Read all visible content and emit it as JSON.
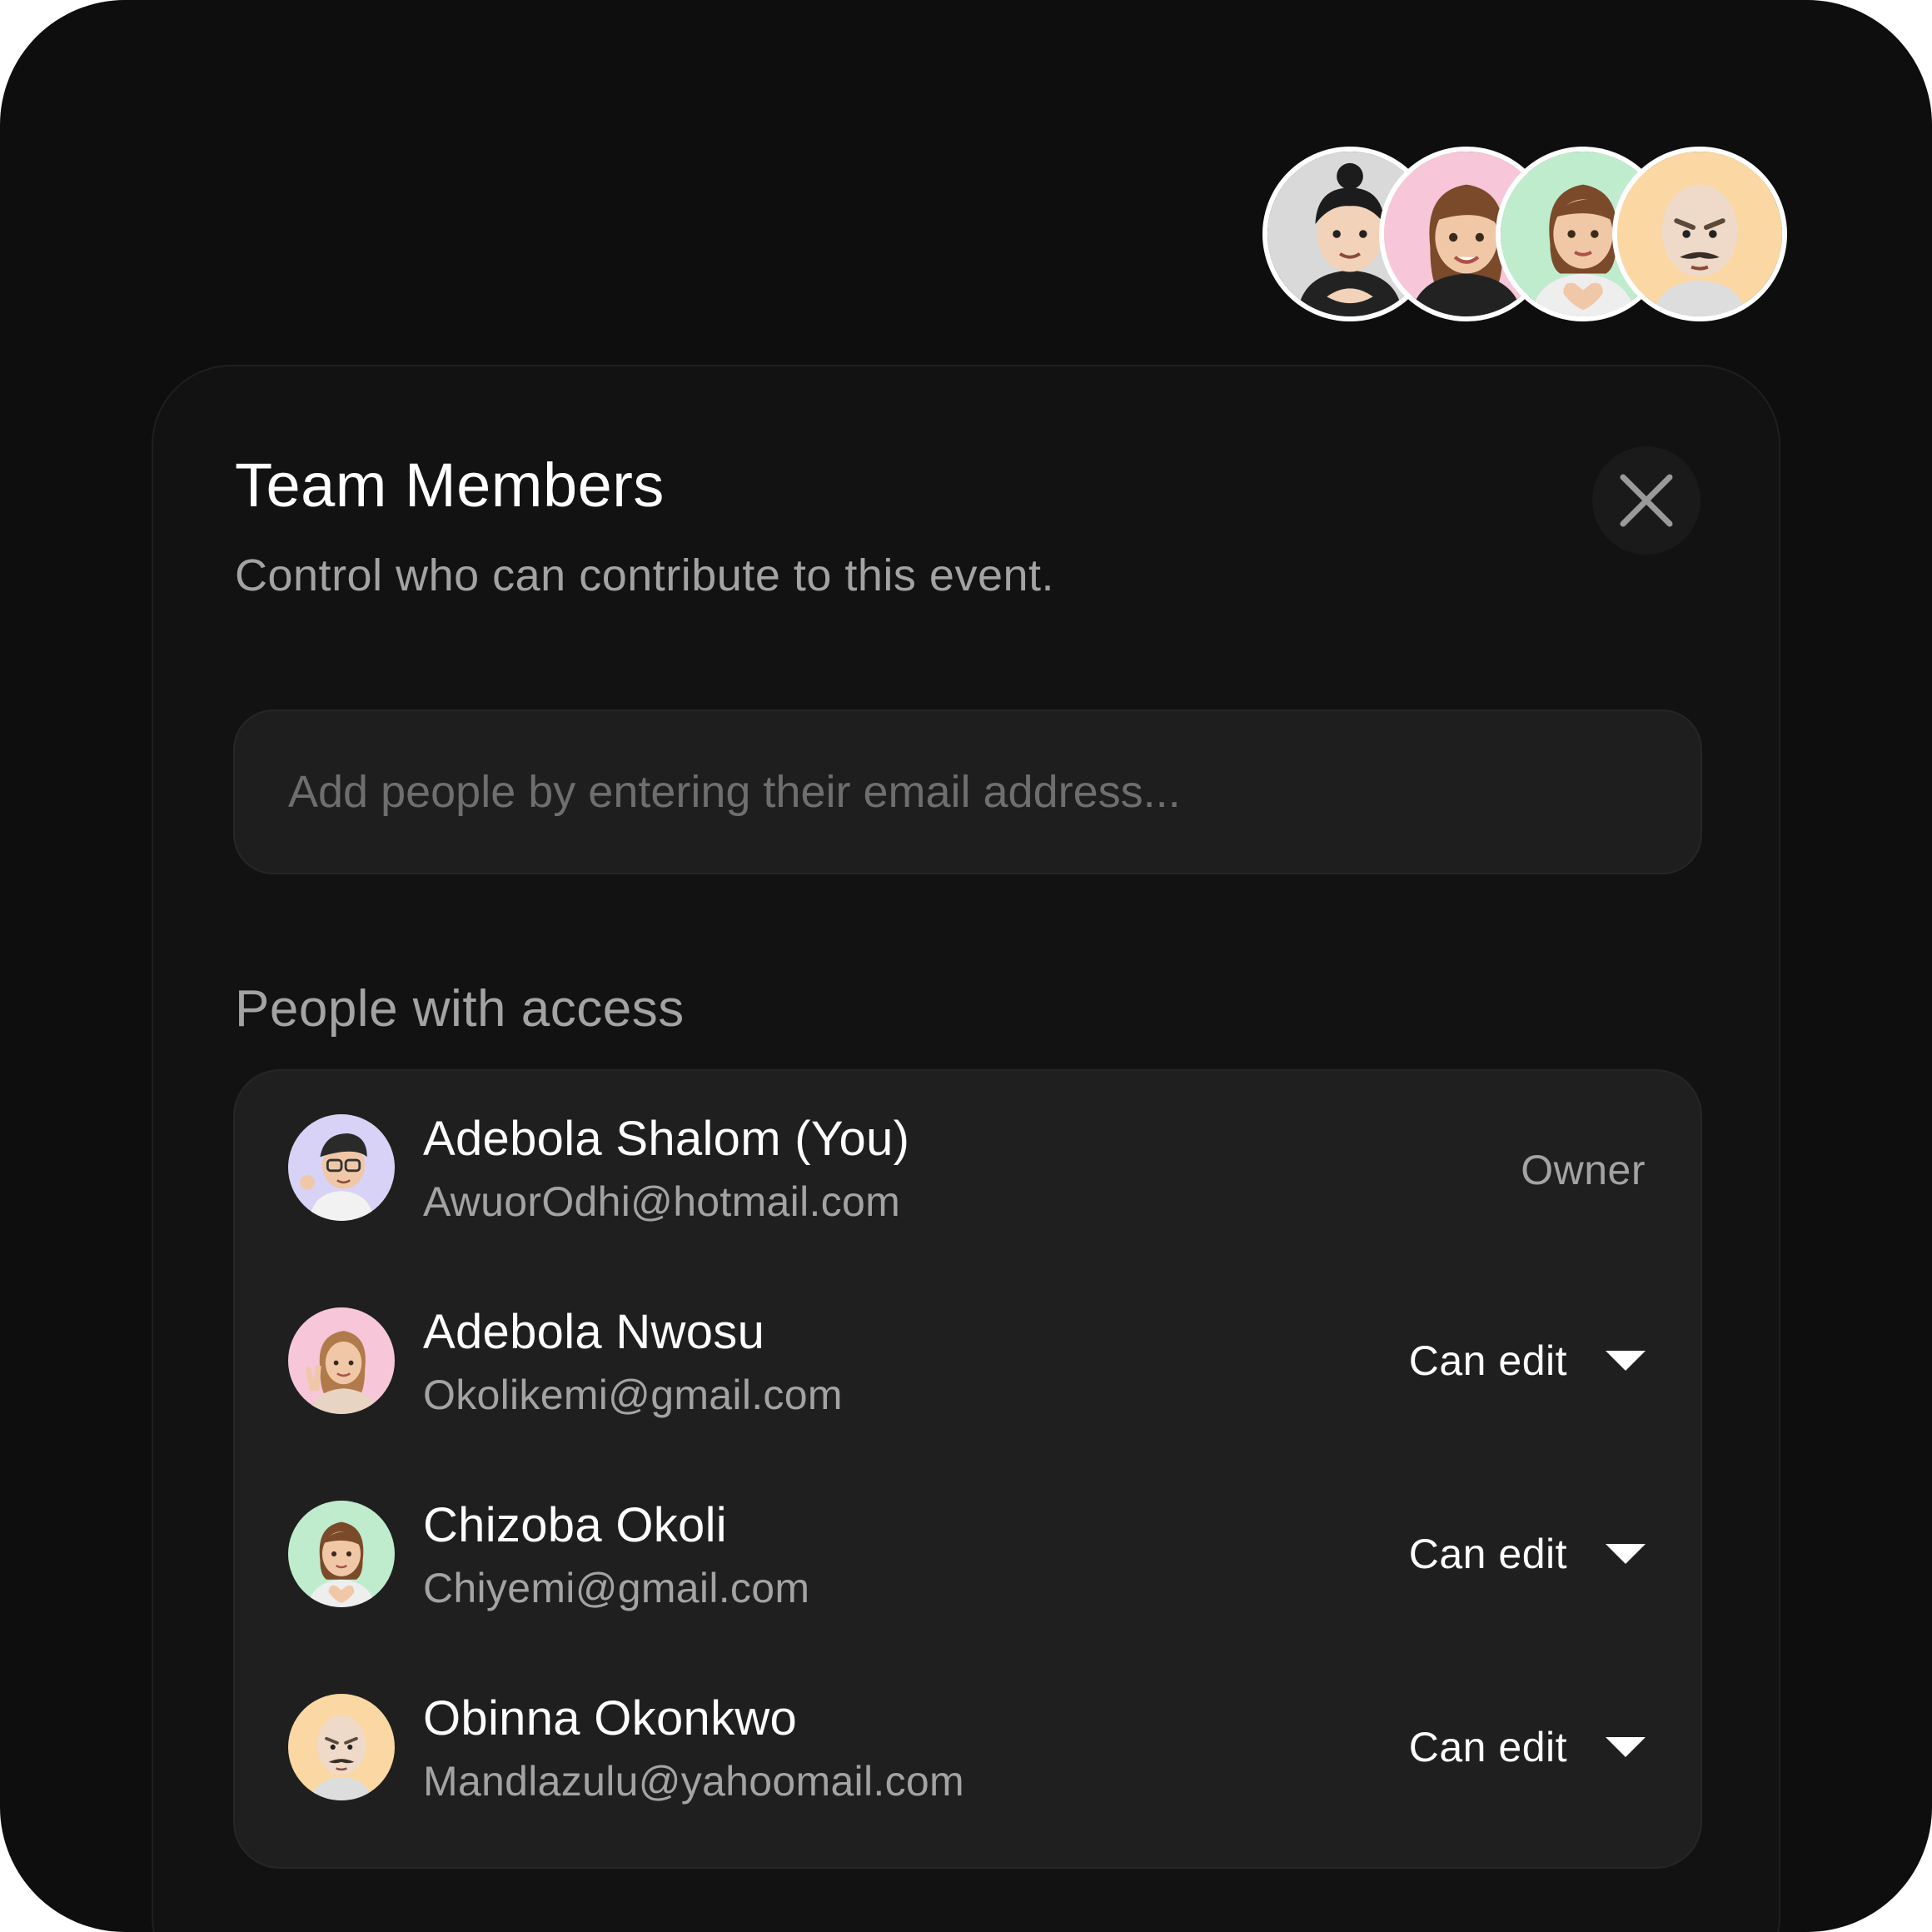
{
  "dialog": {
    "title": "Team Members",
    "subtitle": "Control who can contribute to this event.",
    "close_icon": "close-icon"
  },
  "invite": {
    "placeholder": "Add people by entering their email address...",
    "value": ""
  },
  "access": {
    "label": "People with access",
    "people": [
      {
        "name": "Adebola Shalom (You)",
        "email": "AwuorOdhi@hotmail.com",
        "role": "Owner",
        "editable": false,
        "avatar_bg": "#d9d2f7"
      },
      {
        "name": "Adebola Nwosu",
        "email": "Okolikemi@gmail.com",
        "role": "Can edit",
        "editable": true,
        "avatar_bg": "#f7c6d9"
      },
      {
        "name": "Chizoba Okoli",
        "email": "Chiyemi@gmail.com",
        "role": "Can edit",
        "editable": true,
        "avatar_bg": "#bfeccd"
      },
      {
        "name": "Obinna Okonkwo",
        "email": "Mandlazulu@yahoomail.com",
        "role": "Can edit",
        "editable": true,
        "avatar_bg": "#fbd7a3"
      }
    ]
  },
  "avatar_stack": {
    "backgrounds": [
      "#d9d9d9",
      "#f7c6d9",
      "#bfeccd",
      "#fbd7a3"
    ]
  },
  "colors": {
    "page_bg": "#0e0e0e",
    "card_bg": "#121212",
    "list_bg": "#1f1f1f",
    "text_primary": "#ffffff",
    "text_secondary": "#a3a3a3"
  }
}
